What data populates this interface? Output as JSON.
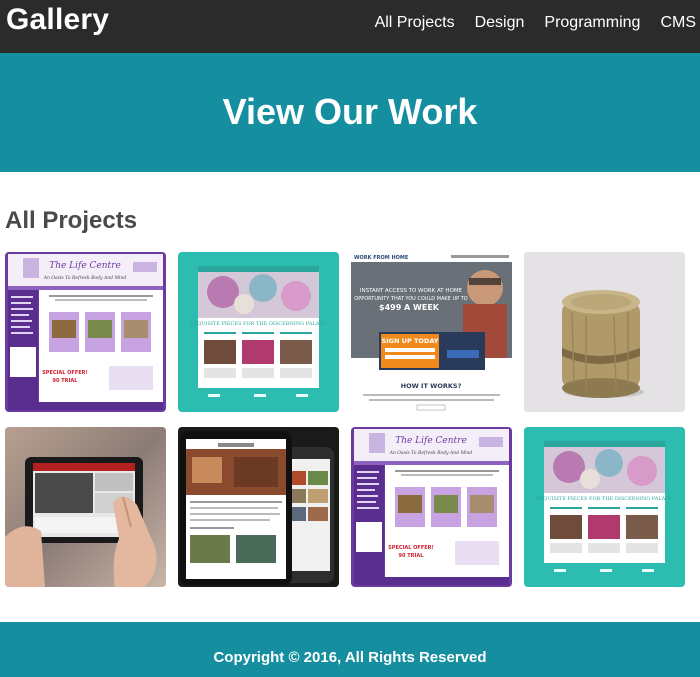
{
  "nav": {
    "brand": "Gallery",
    "links": [
      "All Projects",
      "Design",
      "Programming",
      "CMS"
    ]
  },
  "hero": {
    "title": "View Our Work"
  },
  "section": {
    "title": "All Projects"
  },
  "gallery": {
    "items": [
      {
        "name": "life-centre",
        "texts": [
          "The Life Centre",
          "An Oasis To Refresh Body And Mind",
          "SPECIAL OFFER!",
          "90 TRIAL"
        ]
      },
      {
        "name": "exquisite-pieces",
        "texts": [
          "EXQUISITE PIECES FOR THE DISCERNING PALATE"
        ]
      },
      {
        "name": "work-from-home",
        "texts": [
          "WORK FROM HOME",
          "INSTANT ACCESS TO WORK AT HOME",
          "OPPORTUNITY THAT YOU COULD MAKE UP TO",
          "$499 A WEEK",
          "SIGN UP TODAY",
          "HOW IT WORKS?"
        ]
      },
      {
        "name": "wooden-stool",
        "texts": []
      },
      {
        "name": "tablet-hands",
        "texts": []
      },
      {
        "name": "devices-mockup",
        "texts": []
      },
      {
        "name": "life-centre",
        "texts": [
          "The Life Centre",
          "An Oasis To Refresh Body And Mind",
          "SPECIAL OFFER!",
          "90 TRIAL"
        ]
      },
      {
        "name": "exquisite-pieces",
        "texts": [
          "EXQUISITE PIECES FOR THE DISCERNING PALATE"
        ]
      }
    ]
  },
  "colors": {
    "nav": "#2b2b2b",
    "accent": "#158fa0",
    "heading": "#4a4a4a",
    "purple": "#6b3aa0",
    "teal_tile": "#2cbcb0",
    "orange": "#f08a1c"
  },
  "footer": {
    "copyright": "Copyright © 2016, All Rights Reserved"
  }
}
